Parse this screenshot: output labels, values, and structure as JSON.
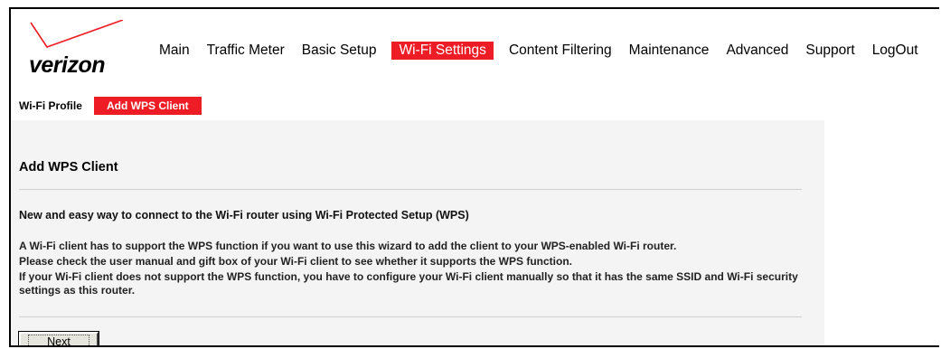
{
  "brand": {
    "logo_text": "verizon",
    "accent_color": "#ee1c25"
  },
  "main_nav": [
    {
      "label": "Main",
      "active": false
    },
    {
      "label": "Traffic Meter",
      "active": false
    },
    {
      "label": "Basic Setup",
      "active": false
    },
    {
      "label": "Wi-Fi Settings",
      "active": true
    },
    {
      "label": "Content Filtering",
      "active": false
    },
    {
      "label": "Maintenance",
      "active": false
    },
    {
      "label": "Advanced",
      "active": false
    },
    {
      "label": "Support",
      "active": false
    },
    {
      "label": "LogOut",
      "active": false
    }
  ],
  "sub_nav": [
    {
      "label": "Wi-Fi Profile",
      "active": false
    },
    {
      "label": "Add WPS Client",
      "active": true
    }
  ],
  "page": {
    "title": "Add WPS Client",
    "section_heading": "New and easy way to connect to the Wi-Fi router using Wi-Fi Protected Setup (WPS)",
    "paragraphs": [
      "A Wi-Fi client has to support the WPS function if you want to use this wizard to add the client to your WPS-enabled Wi-Fi router.",
      "Please check the user manual and gift box of your Wi-Fi client to see whether it supports the WPS function.",
      "If your Wi-Fi client does not support the WPS function, you have to configure your Wi-Fi client manually so that it has the same SSID and Wi-Fi security settings as this router."
    ],
    "next_button": "Next"
  }
}
